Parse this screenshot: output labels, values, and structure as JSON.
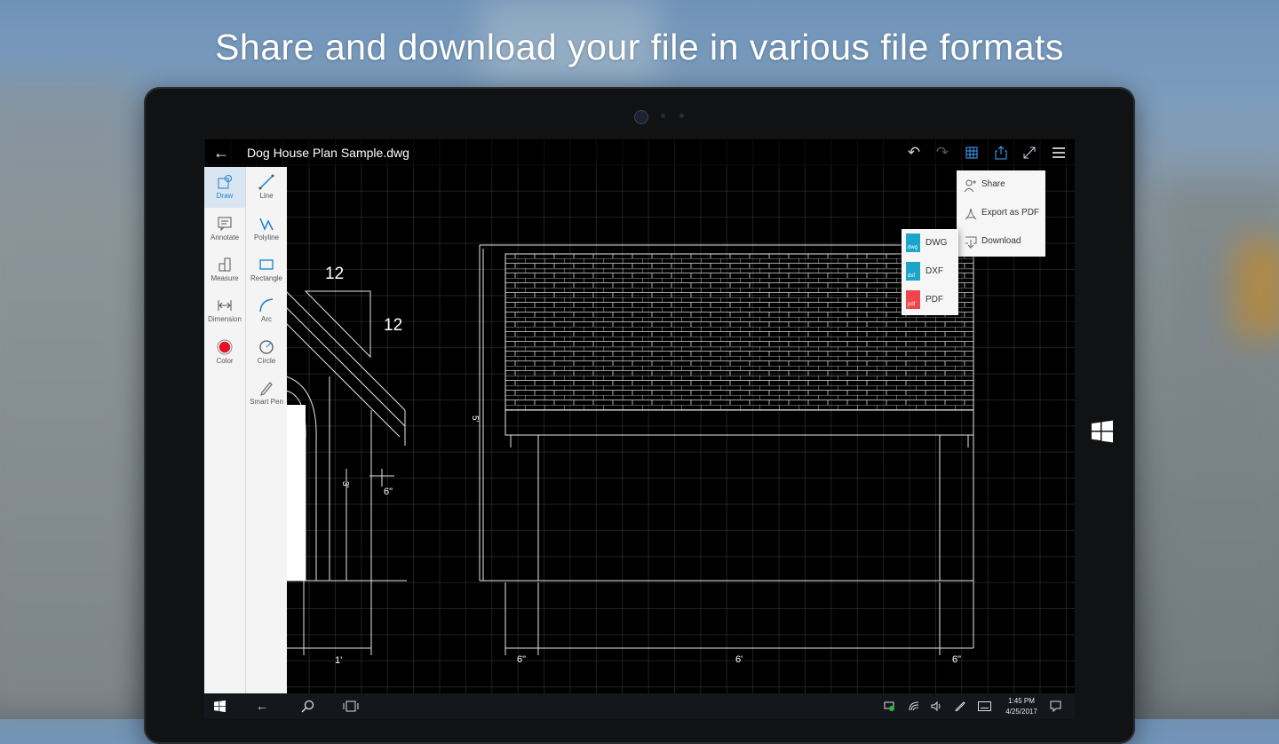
{
  "headline": "Share and download your file in various file formats",
  "app": {
    "doc_title": "Dog House Plan Sample.dwg"
  },
  "toolbar": {
    "back_icon": "arrow-left-icon",
    "undo_icon": "undo-icon",
    "redo_icon": "redo-icon",
    "grid_icon": "grid-icon",
    "share_icon": "share-icon",
    "fullscreen_icon": "expand-icon",
    "menu_icon": "hamburger-icon"
  },
  "tools": {
    "left": [
      {
        "label": "Draw",
        "icon": "draw-icon",
        "selected": true
      },
      {
        "label": "Annotate",
        "icon": "annotate-icon"
      },
      {
        "label": "Measure",
        "icon": "measure-icon"
      },
      {
        "label": "Dimension",
        "icon": "dimension-icon"
      },
      {
        "label": "Color",
        "icon": "color-icon"
      }
    ],
    "right": [
      {
        "label": "Line",
        "icon": "line-icon"
      },
      {
        "label": "Polyline",
        "icon": "polyline-icon"
      },
      {
        "label": "Rectangle",
        "icon": "rectangle-icon"
      },
      {
        "label": "Arc",
        "icon": "arc-icon"
      },
      {
        "label": "Circle",
        "icon": "circle-icon"
      },
      {
        "label": "Smart Pen",
        "icon": "smart-pen-icon"
      }
    ]
  },
  "share_menu": {
    "items": [
      {
        "label": "Share",
        "icon": "add-person-icon"
      },
      {
        "label": "Export as PDF",
        "icon": "pdf-export-icon"
      },
      {
        "label": "Download",
        "icon": "download-icon"
      }
    ]
  },
  "format_menu": {
    "items": [
      {
        "label": "DWG",
        "tag": "dwg",
        "color": "#1ba6c9"
      },
      {
        "label": "DXF",
        "tag": "dxf",
        "color": "#1ba6c9"
      },
      {
        "label": "PDF",
        "tag": "pdf",
        "color": "#f0454d"
      }
    ]
  },
  "drawing": {
    "roof_slope_run": "12",
    "roof_slope_rise": "12",
    "dim_height_right": "5'",
    "dim_door_height": "3'",
    "dim_eave": "6\"",
    "dim_door_width": "1'",
    "dim_left_overhang": "6\"",
    "dim_width": "6'",
    "dim_right_overhang": "6\""
  },
  "taskbar": {
    "time": "1:45 PM",
    "date": "4/25/2017"
  },
  "colors": {
    "accent": "#3fa6ff",
    "canvas": "#000000"
  }
}
